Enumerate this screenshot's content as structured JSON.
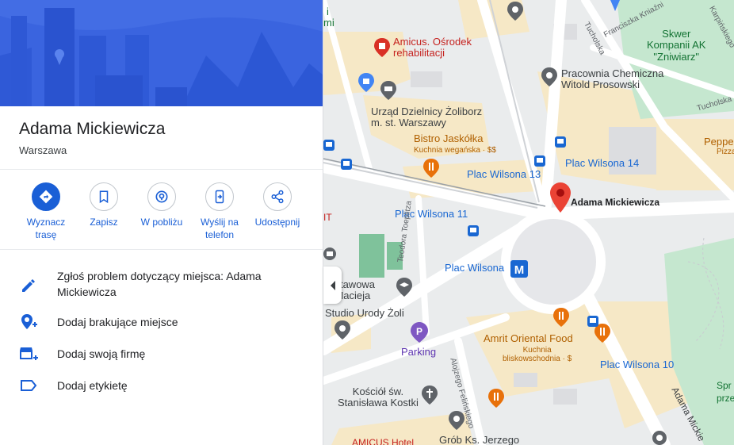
{
  "place": {
    "title": "Adama Mickiewicza",
    "subtitle": "Warszawa"
  },
  "actions": [
    {
      "label": "Wyznacz trasę",
      "icon": "directions-icon"
    },
    {
      "label": "Zapisz",
      "icon": "bookmark-icon"
    },
    {
      "label": "W pobliżu",
      "icon": "nearby-icon"
    },
    {
      "label": "Wyślij na telefon",
      "icon": "send-to-phone-icon"
    },
    {
      "label": "Udostępnij",
      "icon": "share-icon"
    }
  ],
  "menu": [
    {
      "label": "Zgłoś problem dotyczący miejsca: Adama Mickiewicza",
      "icon": "edit-icon"
    },
    {
      "label": "Dodaj brakujące miejsce",
      "icon": "add-location-icon"
    },
    {
      "label": "Dodaj swoją firmę",
      "icon": "add-business-icon"
    },
    {
      "label": "Dodaj etykietę",
      "icon": "label-icon"
    }
  ],
  "map": {
    "selected_pin_label": "Adama Mickiewicza",
    "labels": {
      "amicus": "Amicus. Ośrodek\nrehabilitacji",
      "urzad": "Urząd Dzielnicy Żoliborz\nm. st. Warszawy",
      "bistro": "Bistro Jaskółka",
      "bistro_sub": "Kuchnia wegańska · $$",
      "plac_wilsona_13": "Plac Wilsona 13",
      "plac_wilsona_14": "Plac Wilsona 14",
      "plac_wilsona_11": "Plac Wilsona 11",
      "plac_wilsona_metro": "Plac Wilsona",
      "plac_wilsona_10": "Plac Wilsona 10",
      "pracownia": "Pracownia Chemiczna\nWitold Prosowski",
      "skwer": "Skwer\nKompanii AK\n\"Zniwiarz\"",
      "peppe": "Peppe",
      "pizza": "Pizza",
      "szkola": "odstawowa\nn. Macieja",
      "studio": "Studio Urody Żoli",
      "parking": "Parking",
      "amrit": "Amrit Oriental Food",
      "amrit_sub": "Kuchnia\nbliskowschodnia · $",
      "kosciol": "Kościół św.\nStanisława Kostki",
      "grob": "Grób Ks. Jerzego",
      "amicus_hotel": "AMICUS Hotel",
      "spr": "Spr",
      "przestr": "przestr",
      "street_teodora": "Teodora Toeplitza",
      "street_feli": "Alojzego Felińskiego",
      "street_mick": "Adama Mickie",
      "street_tuch": "Tucholska",
      "street_tuch2": "Tucholska",
      "street_franc": "Franciszka Kniaźni",
      "street_karp": "Karpińskiego",
      "left_i": "i",
      "left_it": "IT",
      "left_mi": "mi"
    }
  },
  "colors": {
    "accent": "#1a5fd6",
    "park": "#c3e6cb",
    "building": "#f5e6c4",
    "poi_red": "#d93025",
    "poi_orange": "#e8710a",
    "transit_blue": "#1967d2"
  }
}
